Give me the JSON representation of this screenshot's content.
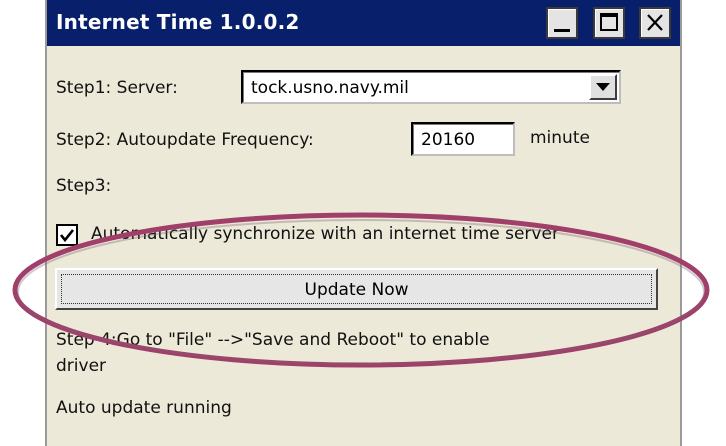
{
  "window": {
    "title": "Internet Time 1.0.0.2",
    "controls": {
      "minimize": "minimize-icon",
      "maximize": "maximize-icon",
      "close": "close-icon"
    }
  },
  "step1": {
    "label": "Step1: Server:",
    "server_value": "tock.usno.navy.mil"
  },
  "step2": {
    "label": "Step2: Autoupdate Frequency:",
    "frequency_value": "20160",
    "unit": "minute"
  },
  "step3": {
    "label": "Step3:",
    "checkbox_checked": true,
    "checkbox_label": "Automatically synchronize with an internet time server",
    "update_button": "Update Now"
  },
  "step4": {
    "line1": "Step 4:Go to \"File\" -->\"Save and Reboot\" to enable",
    "line2": "driver"
  },
  "status": {
    "text": "Auto update running"
  },
  "annotation": {
    "color": "#a0406a"
  }
}
